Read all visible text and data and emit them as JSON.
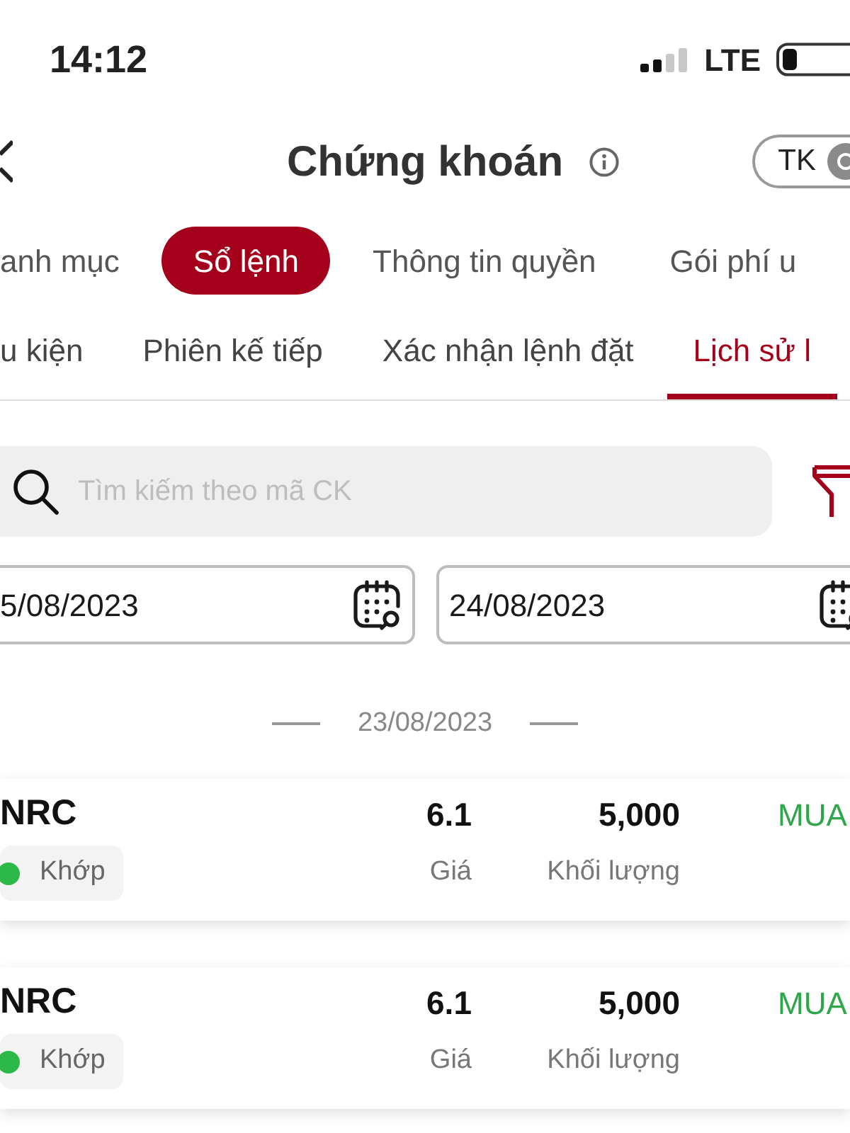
{
  "status_bar": {
    "time": "14:12",
    "network": "LTE"
  },
  "header": {
    "title": "Chứng khoán",
    "account_button": "TK"
  },
  "tabs": [
    {
      "label": "anh mục",
      "selected": false
    },
    {
      "label": "Sổ lệnh",
      "selected": true
    },
    {
      "label": "Thông tin quyền",
      "selected": false
    },
    {
      "label": "Gói phí u",
      "selected": false
    }
  ],
  "sub_tabs": [
    {
      "label": "u kiện",
      "selected": false
    },
    {
      "label": "Phiên kế tiếp",
      "selected": false
    },
    {
      "label": "Xác nhận lệnh đặt",
      "selected": false
    },
    {
      "label": "Lịch sử l",
      "selected": true
    }
  ],
  "search": {
    "placeholder": "Tìm kiếm theo mã CK"
  },
  "date_range": {
    "from": "5/08/2023",
    "to": "24/08/2023"
  },
  "order_groups": [
    {
      "date": "23/08/2023",
      "orders": [
        {
          "symbol": "NRC",
          "status": "Khớp",
          "color": "#2db84a",
          "price": "6.1",
          "price_label": "Giá",
          "volume": "5,000",
          "volume_label": "Khối lượng",
          "side": {
            "label": "MUA",
            "kind": "buy"
          }
        },
        {
          "symbol": "NRC",
          "status": "Khớp",
          "color": "#2db84a",
          "price": "6.1",
          "price_label": "Giá",
          "volume": "5,000",
          "volume_label": "Khối lượng",
          "side": {
            "label": "MUA",
            "kind": "buy"
          }
        }
      ]
    }
  ]
}
